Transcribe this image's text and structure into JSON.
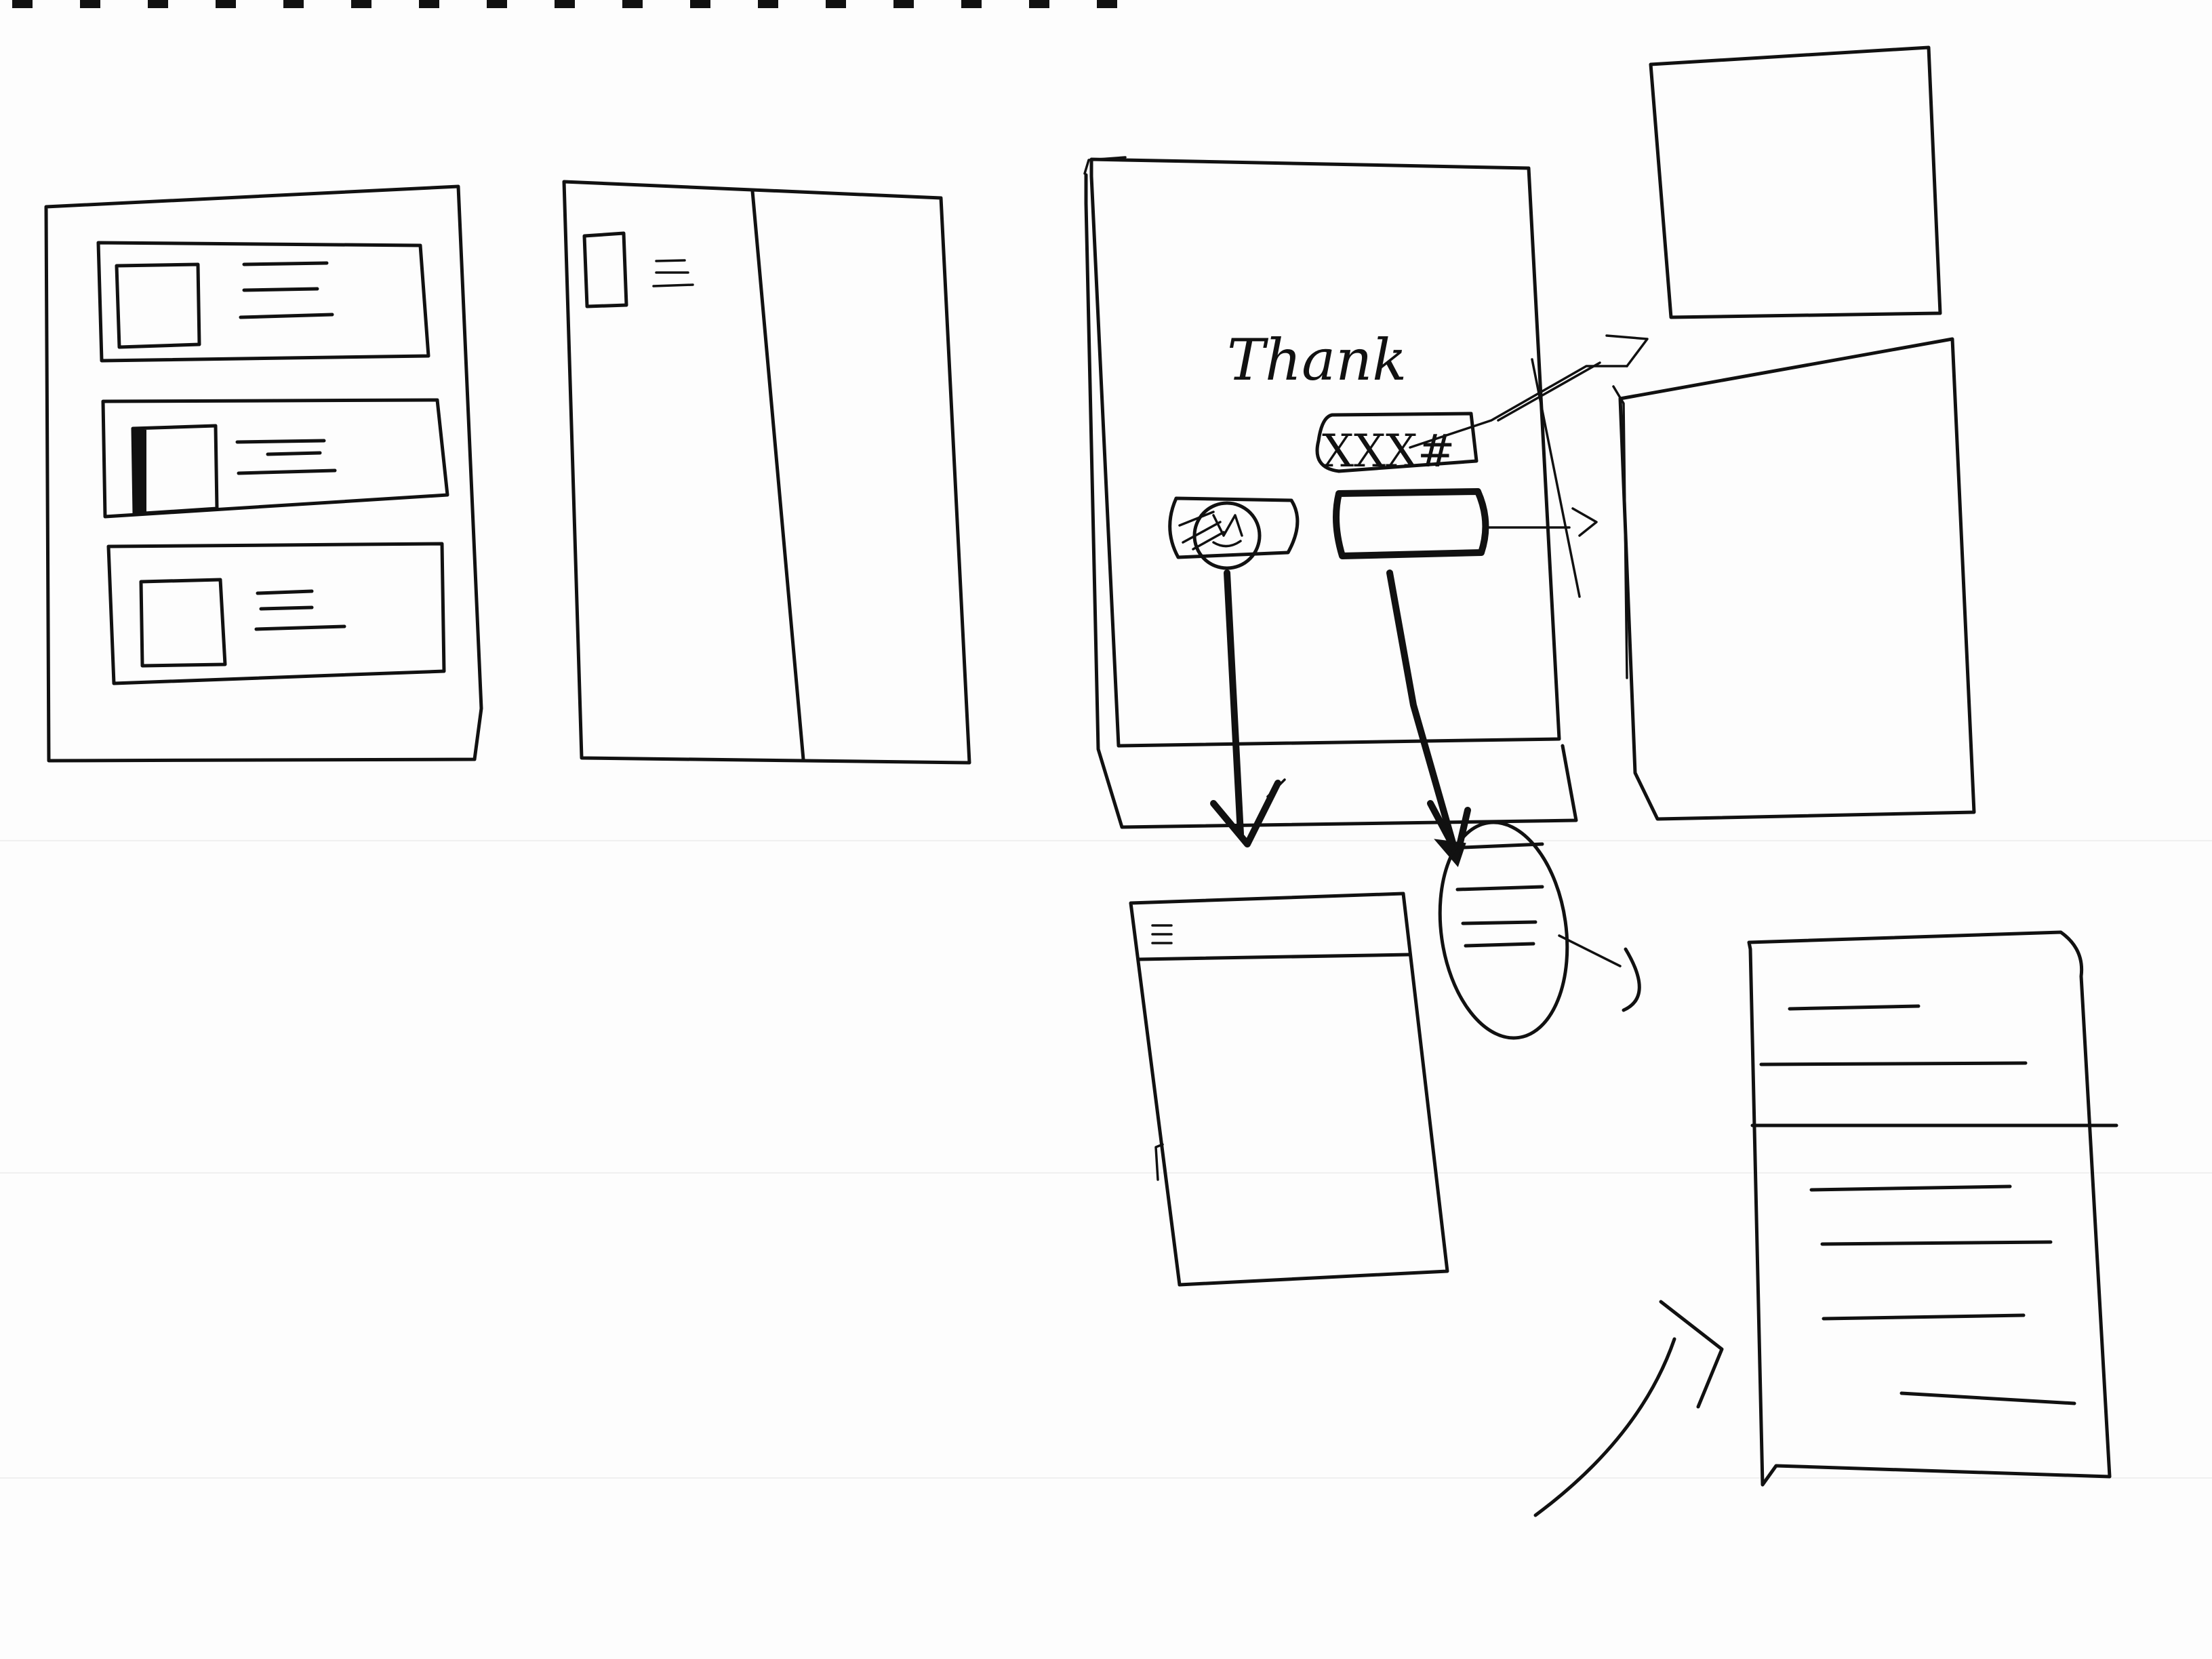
{
  "sketch": {
    "frame3": {
      "title_text": "Thank",
      "order_label": "XXX#"
    }
  }
}
